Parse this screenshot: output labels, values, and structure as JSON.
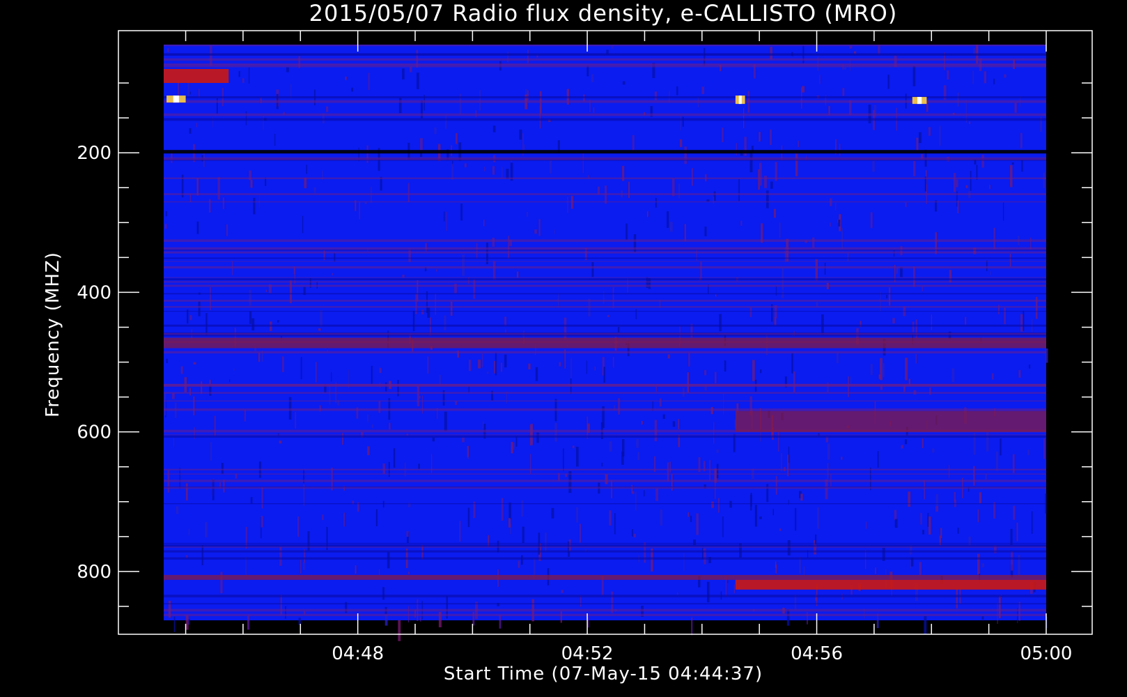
{
  "chart_data": {
    "type": "heatmap",
    "title": "2015/05/07  Radio flux density, e-CALLISTO (MRO)",
    "xlabel": "Start Time (07-May-15 04:44:37)",
    "ylabel": "Frequency (MHZ)",
    "x_unit": "UT time (hh:mm)",
    "x_range": [
      "04:44:37",
      "05:00:00"
    ],
    "x_major_ticks": [
      "04:48",
      "04:52",
      "04:56",
      "05:00"
    ],
    "y_range": [
      45,
      870
    ],
    "y_inverted": true,
    "y_major_ticks": [
      200,
      400,
      600,
      800
    ],
    "colormap": "blue-red-yellow-white",
    "background_color": "#0a1cf0",
    "features": [
      {
        "t_start": "04:44:37",
        "t_end": "04:45:45",
        "f_low": 80,
        "f_high": 100,
        "level": "high"
      },
      {
        "t_start": "04:44:40",
        "t_end": "04:45:00",
        "f_low": 118,
        "f_high": 128,
        "level": "peak"
      },
      {
        "t_start": "04:54:35",
        "t_end": "04:54:45",
        "f_low": 118,
        "f_high": 130,
        "level": "peak"
      },
      {
        "t_start": "04:57:40",
        "t_end": "04:57:55",
        "f_low": 120,
        "f_high": 130,
        "level": "peak"
      },
      {
        "t_start": "04:54:35",
        "t_end": "05:00:00",
        "f_low": 812,
        "f_high": 826,
        "level": "high"
      },
      {
        "t_start": "04:54:35",
        "t_end": "05:00:00",
        "f_low": 570,
        "f_high": 600,
        "level": "medium"
      },
      {
        "t_start": "04:44:37",
        "t_end": "05:00:00",
        "f_low": 465,
        "f_high": 480,
        "level": "medium"
      },
      {
        "t_start": "04:44:37",
        "t_end": "05:00:00",
        "f_low": 196,
        "f_high": 201,
        "level": "low"
      },
      {
        "t_start": "04:44:37",
        "t_end": "05:00:00",
        "f_low": 805,
        "f_high": 812,
        "level": "medium"
      }
    ]
  }
}
